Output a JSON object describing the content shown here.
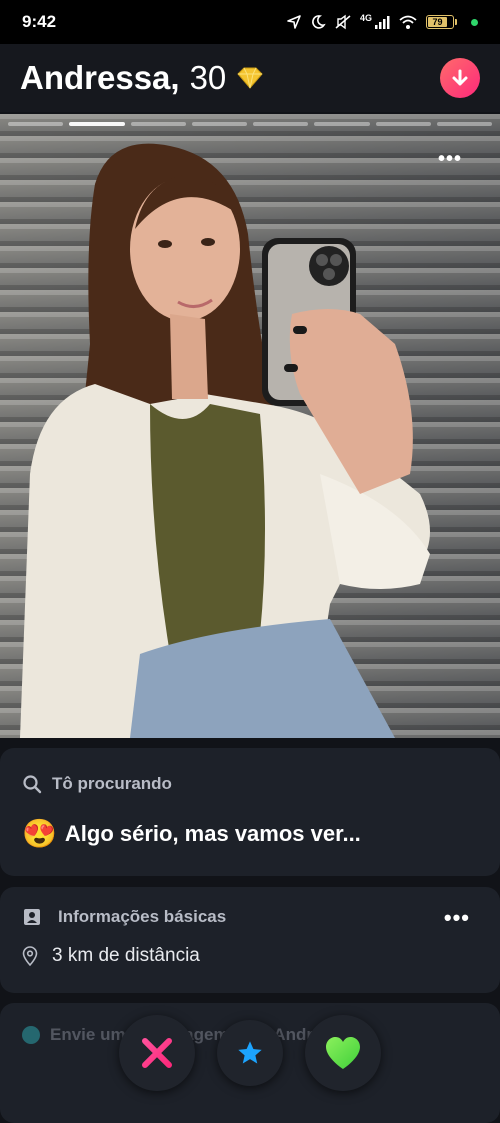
{
  "status_bar": {
    "time": "9:42",
    "network": "4G",
    "battery": "79"
  },
  "profile": {
    "name": "Andressa,",
    "age": "30"
  },
  "photo": {
    "more_label": "•••",
    "photo_count": 8,
    "active_index": 1
  },
  "looking_for": {
    "heading": "Tô procurando",
    "emoji": "😍",
    "value": "Algo sério, mas vamos ver..."
  },
  "basics": {
    "heading": "Informações básicas",
    "more_label": "•••",
    "distance": "3 km de distância"
  },
  "message_card": {
    "text": "Envie uma mensagem para Andressa"
  },
  "colors": {
    "background": "#111318",
    "card": "#1d2129",
    "nope": "#fd297b",
    "super_like": "#1ca4ff",
    "like": "#6fe74a",
    "accent": "#fd5068"
  },
  "icons": {
    "header_badge": "gem-icon",
    "collapse": "arrow-down-icon",
    "looking_for": "search-icon",
    "basics": "id-card-icon",
    "distance": "location-pin-icon",
    "nope": "close-icon",
    "super_like": "star-icon",
    "like": "heart-icon"
  }
}
